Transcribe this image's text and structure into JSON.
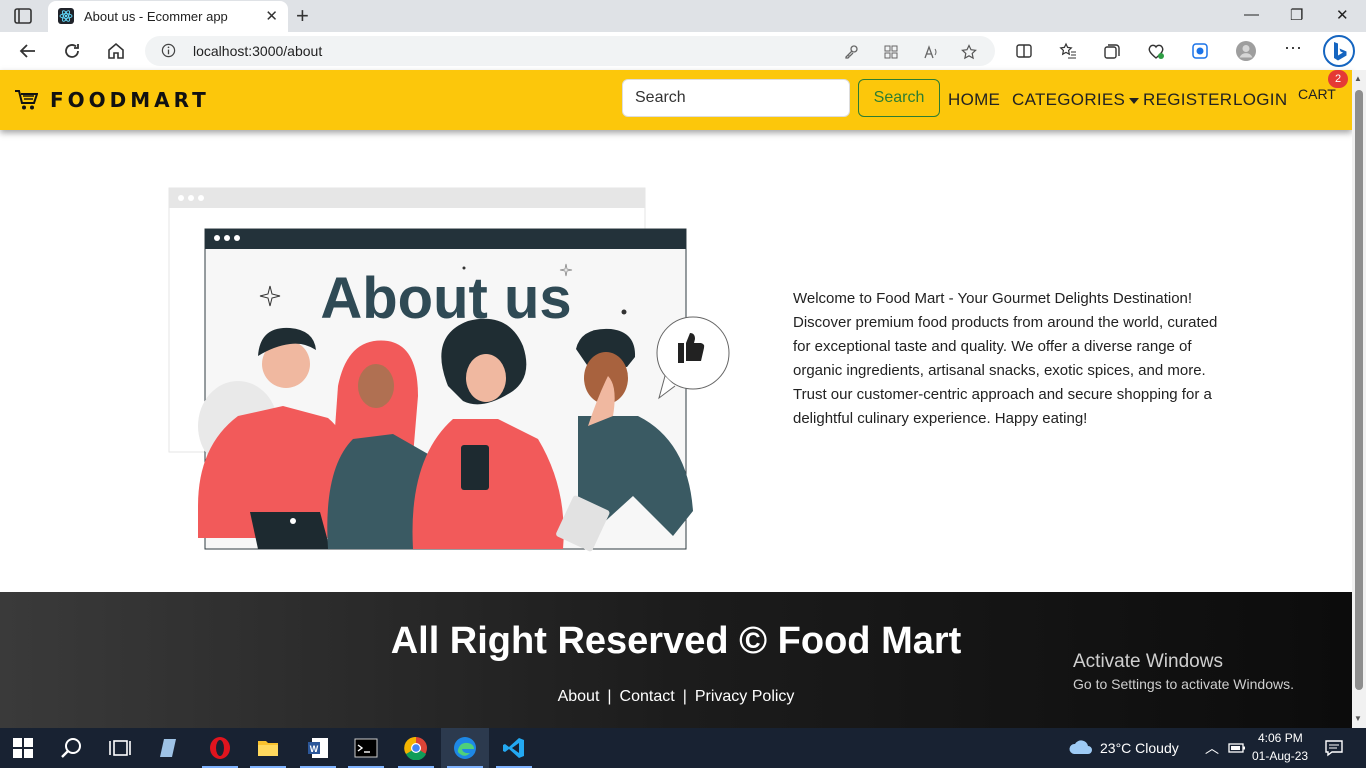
{
  "browser": {
    "tab_title": "About us - Ecommer app",
    "url": "localhost:3000/about"
  },
  "navbar": {
    "brand": "FOODMART",
    "search_placeholder": "Search",
    "search_button": "Search",
    "links": [
      "HOME",
      "CATEGORIES",
      "REGISTER",
      "LOGIN"
    ],
    "cart_label": "CART",
    "cart_count": "2"
  },
  "illustration": {
    "heading": "About us"
  },
  "about": {
    "text": "Welcome to Food Mart - Your Gourmet Delights Destination! Discover premium food products from around the world, curated for exceptional taste and quality. We offer a diverse range of organic ingredients, artisanal snacks, exotic spices, and more. Trust our customer-centric approach and secure shopping for a delightful culinary experience. Happy eating!"
  },
  "footer": {
    "title": "All Right Reserved © Food Mart",
    "links": [
      "About",
      "Contact",
      "Privacy Policy"
    ]
  },
  "watermark": {
    "title": "Activate Windows",
    "subtitle": "Go to Settings to activate Windows."
  },
  "taskbar": {
    "weather": "23°C  Cloudy",
    "time": "4:06 PM",
    "date": "01-Aug-23"
  },
  "colors": {
    "navbar": "#fcc70b",
    "search_button": "#2e7d32",
    "badge": "#e53935",
    "illustration_accent": "#f25a5a",
    "illustration_dark": "#2f4a55"
  }
}
